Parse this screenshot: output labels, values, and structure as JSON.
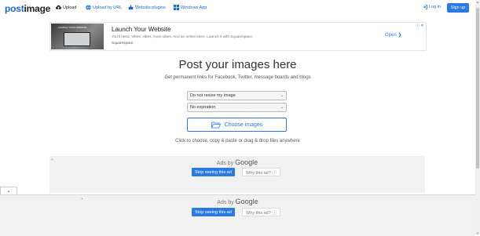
{
  "header": {
    "logo_part1": "post",
    "logo_part2": "image",
    "nav": {
      "upload": "Upload",
      "upload_by_url": "Upload by URL",
      "website_plugins": "Website plugins",
      "windows_app": "Windows App"
    },
    "login": "Log in",
    "signup": "Sign up"
  },
  "top_ad": {
    "thumb_text": "LAUNCH YOUR WEBSITE",
    "title": "Launch Your Website",
    "description": "You'll need: Vibes, vibes, more vibes. And an online store. Launch it with Squarespace.",
    "brand": "Squarespace",
    "cta": "Open"
  },
  "main": {
    "title": "Post your images here",
    "subtitle": "Get permanent links for Facebook, Twitter, message boards and blogs",
    "resize_select": "Do not resize my image",
    "expiration_select": "No expiration",
    "choose_button": "Choose images",
    "hint": "Click to choose, copy & paste or drag & drop files anywhere"
  },
  "google_ad": {
    "ads_by": "Ads by",
    "google": "Google",
    "stop": "Stop seeing this ad",
    "why": "Why this ad? ⓘ"
  },
  "colors": {
    "accent": "#2a7ae2",
    "link": "#1b6ac9",
    "ad_background": "#f1f1f1"
  }
}
